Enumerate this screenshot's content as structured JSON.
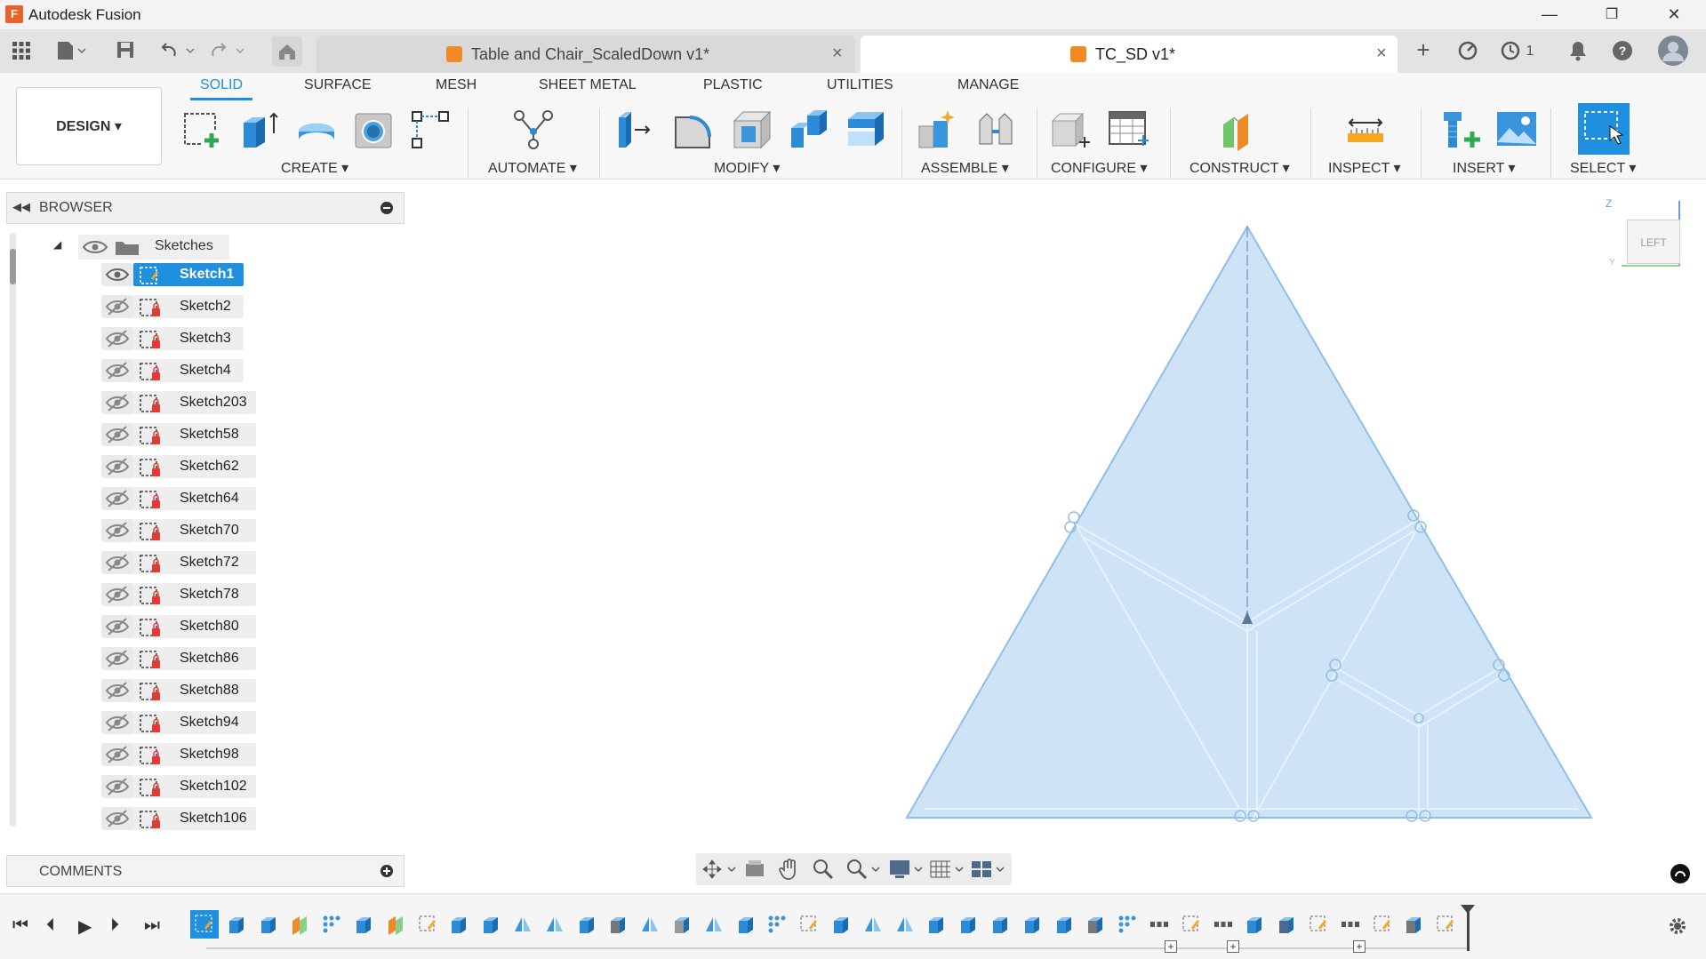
{
  "app": {
    "title": "Autodesk Fusion",
    "logo_letter": "F"
  },
  "window_controls": {
    "minimize": "—",
    "restore": "❐",
    "close": "✕"
  },
  "tabs": [
    {
      "label": "Table and Chair_ScaledDown v1*",
      "active": false
    },
    {
      "label": "TC_SD v1*",
      "active": true
    }
  ],
  "tab_bar_right": {
    "jobs_count": "1"
  },
  "ribbon": {
    "workspace_button": "DESIGN ▾",
    "workspace_tabs": [
      "SOLID",
      "SURFACE",
      "MESH",
      "SHEET METAL",
      "PLASTIC",
      "UTILITIES",
      "MANAGE"
    ],
    "active_tab": "SOLID",
    "groups": [
      "CREATE ▾",
      "AUTOMATE ▾",
      "MODIFY ▾",
      "ASSEMBLE ▾",
      "CONFIGURE ▾",
      "CONSTRUCT ▾",
      "INSPECT ▾",
      "INSERT ▾",
      "SELECT ▾"
    ]
  },
  "browser": {
    "title": "BROWSER",
    "folder": "Sketches",
    "items": [
      {
        "label": "Sketch1",
        "selected": true,
        "visible": true
      },
      {
        "label": "Sketch2"
      },
      {
        "label": "Sketch3"
      },
      {
        "label": "Sketch4"
      },
      {
        "label": "Sketch203"
      },
      {
        "label": "Sketch58"
      },
      {
        "label": "Sketch62"
      },
      {
        "label": "Sketch64"
      },
      {
        "label": "Sketch70"
      },
      {
        "label": "Sketch72"
      },
      {
        "label": "Sketch78"
      },
      {
        "label": "Sketch80"
      },
      {
        "label": "Sketch86"
      },
      {
        "label": "Sketch88"
      },
      {
        "label": "Sketch94"
      },
      {
        "label": "Sketch98"
      },
      {
        "label": "Sketch102"
      },
      {
        "label": "Sketch106"
      }
    ]
  },
  "comments": {
    "title": "COMMENTS"
  },
  "viewcube": {
    "face": "LEFT",
    "axis_z": "Z",
    "axis_y": "Y"
  },
  "colors": {
    "accent": "#1e90e0",
    "sketch_fill": "#cfe3f7",
    "sketch_stroke": "#8fbfe8"
  }
}
